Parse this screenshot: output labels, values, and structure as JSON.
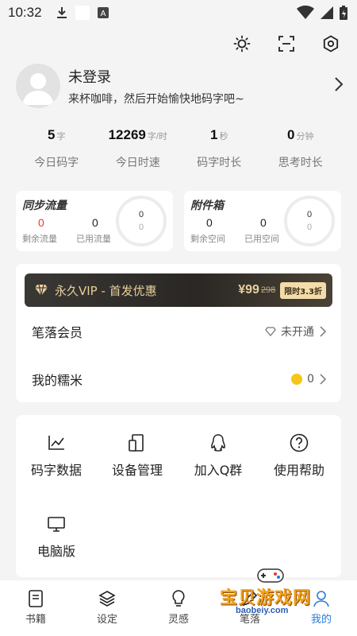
{
  "status_bar": {
    "time": "10:32"
  },
  "profile": {
    "name": "未登录",
    "subtitle": "来杯咖啡，然后开始愉快地码字吧~"
  },
  "stats": [
    {
      "value": "5",
      "unit": "字",
      "label": "今日码字"
    },
    {
      "value": "12269",
      "unit": "字/时",
      "label": "今日时速"
    },
    {
      "value": "1",
      "unit": "秒",
      "label": "码字时长"
    },
    {
      "value": "0",
      "unit": "分钟",
      "label": "思考时长"
    }
  ],
  "sync": {
    "title": "同步流量",
    "remaining_value": "0",
    "remaining_label": "剩余流量",
    "used_value": "0",
    "used_label": "已用流量",
    "ring_top": "0",
    "ring_bottom": "0",
    "remaining_color": "#e53935"
  },
  "attachments": {
    "title": "附件箱",
    "remaining_value": "0",
    "remaining_label": "剩余空间",
    "used_value": "0",
    "used_label": "已用空间",
    "ring_top": "0",
    "ring_bottom": "0"
  },
  "vip": {
    "title": "永久VIP - 首发优惠",
    "price": "¥99",
    "old_price": "298",
    "tag": "限时3.3折"
  },
  "membership": {
    "label": "笔落会员",
    "status": "未开通"
  },
  "nuomi": {
    "label": "我的糯米",
    "value": "0"
  },
  "tools": [
    {
      "label": "码字数据",
      "icon": "chart-icon"
    },
    {
      "label": "设备管理",
      "icon": "device-icon"
    },
    {
      "label": "加入Q群",
      "icon": "qq-icon"
    },
    {
      "label": "使用帮助",
      "icon": "help-icon"
    },
    {
      "label": "电脑版",
      "icon": "monitor-icon"
    }
  ],
  "nav": [
    {
      "label": "书籍",
      "icon": "book-icon"
    },
    {
      "label": "设定",
      "icon": "layers-icon"
    },
    {
      "label": "灵感",
      "icon": "bulb-icon"
    },
    {
      "label": "笔落",
      "icon": "pen-icon"
    },
    {
      "label": "我的",
      "icon": "user-icon"
    }
  ],
  "watermark": {
    "text": "宝贝游戏网",
    "url": "baobeiy.com"
  },
  "colors": {
    "accent": "#2a7bd6",
    "vip_gold": "#e8cf9d",
    "coin": "#f5c518"
  }
}
